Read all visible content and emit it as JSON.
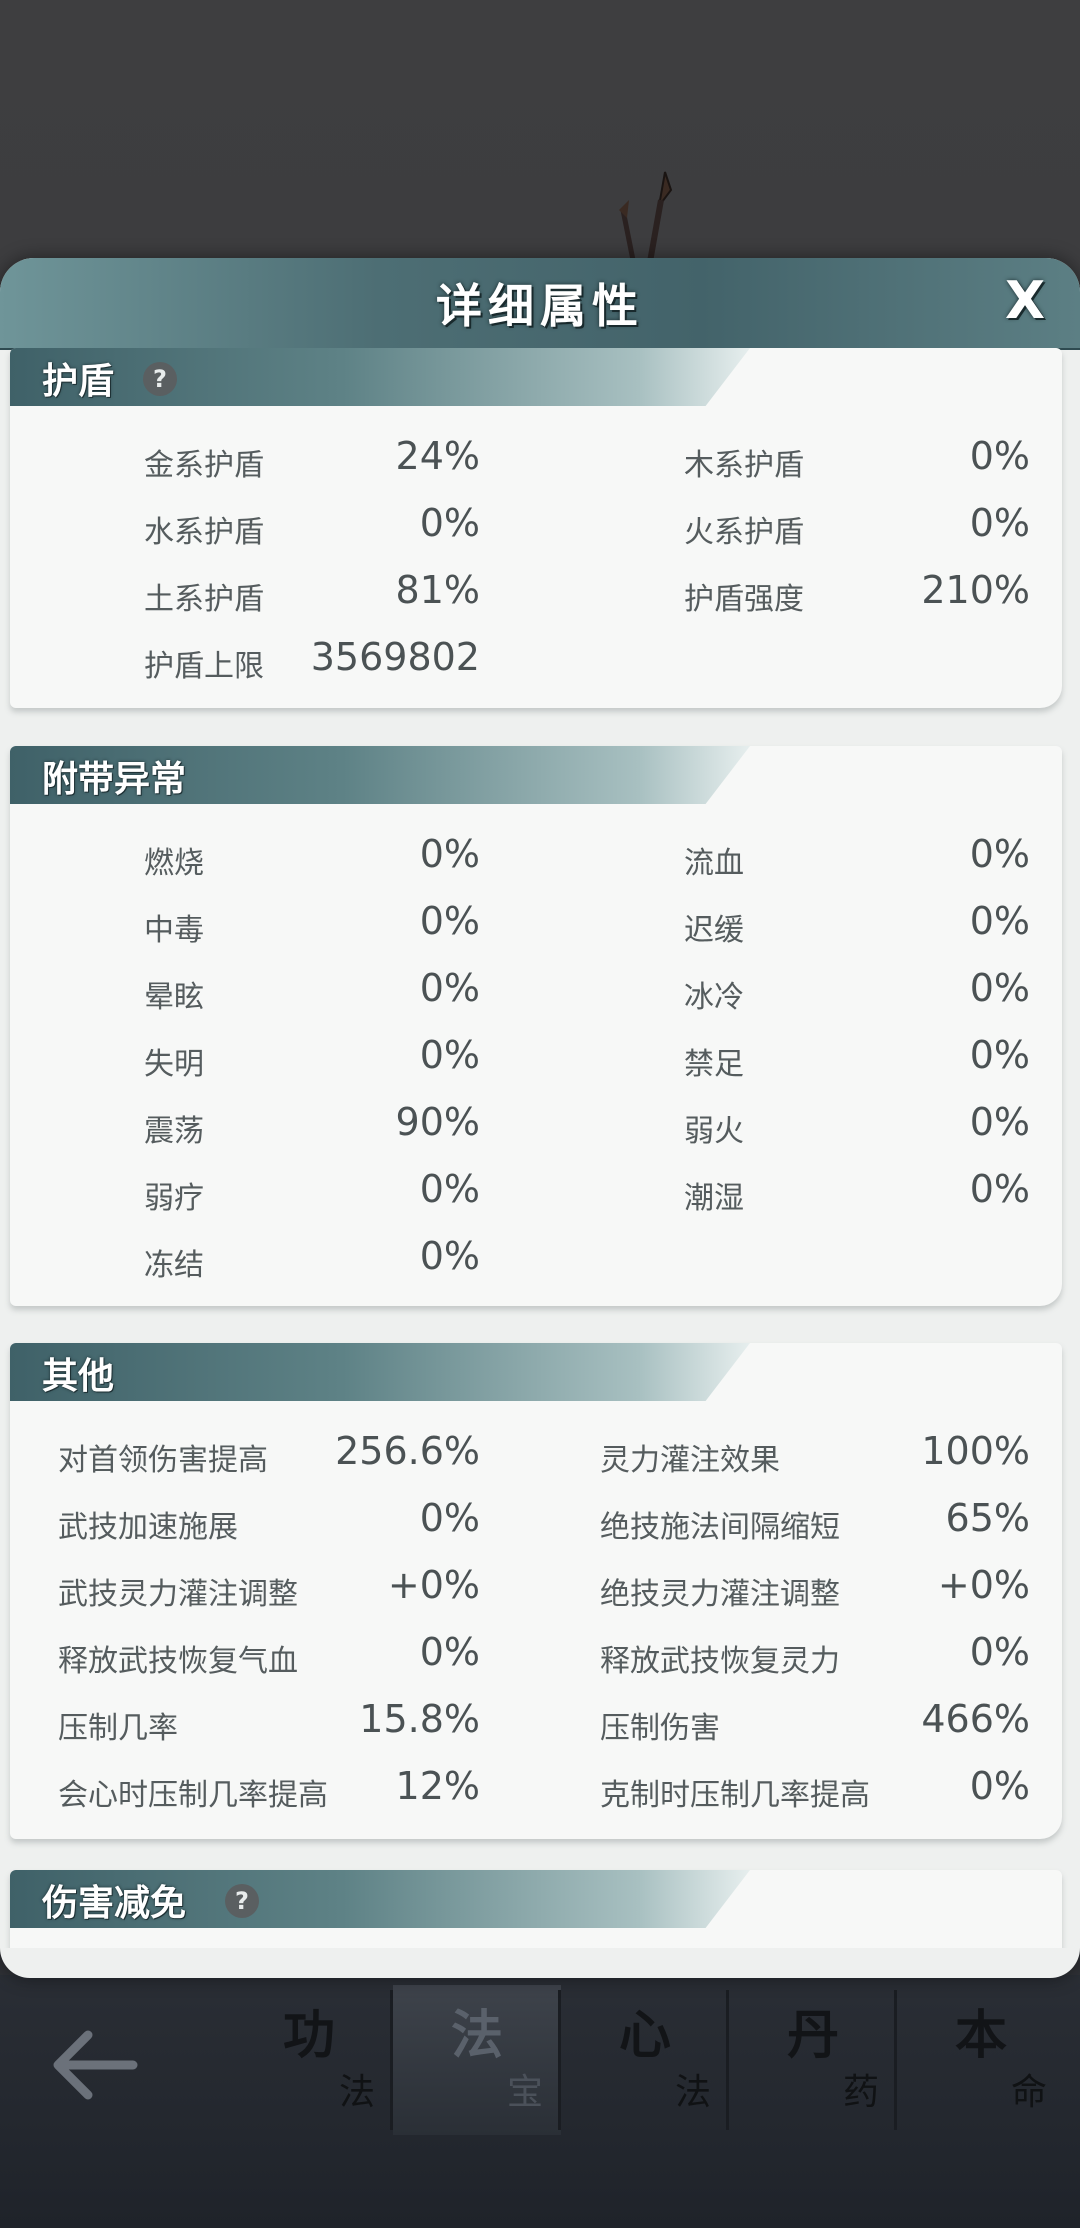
{
  "modal": {
    "title": "详细属性",
    "close_label": "X"
  },
  "sections": {
    "shield": {
      "title": "护盾",
      "help": "?",
      "rows": [
        {
          "left_label": "金系护盾",
          "left_value": "24%",
          "right_label": "木系护盾",
          "right_value": "0%"
        },
        {
          "left_label": "水系护盾",
          "left_value": "0%",
          "right_label": "火系护盾",
          "right_value": "0%"
        },
        {
          "left_label": "土系护盾",
          "left_value": "81%",
          "right_label": "护盾强度",
          "right_value": "210%"
        },
        {
          "left_label": "护盾上限",
          "left_value": "3569802"
        }
      ]
    },
    "ailment": {
      "title": "附带异常",
      "rows": [
        {
          "left_label": "燃烧",
          "left_value": "0%",
          "right_label": "流血",
          "right_value": "0%"
        },
        {
          "left_label": "中毒",
          "left_value": "0%",
          "right_label": "迟缓",
          "right_value": "0%"
        },
        {
          "left_label": "晕眩",
          "left_value": "0%",
          "right_label": "冰冷",
          "right_value": "0%"
        },
        {
          "left_label": "失明",
          "left_value": "0%",
          "right_label": "禁足",
          "right_value": "0%"
        },
        {
          "left_label": "震荡",
          "left_value": "90%",
          "right_label": "弱火",
          "right_value": "0%"
        },
        {
          "left_label": "弱疗",
          "left_value": "0%",
          "right_label": "潮湿",
          "right_value": "0%"
        },
        {
          "left_label": "冻结",
          "left_value": "0%"
        }
      ]
    },
    "other": {
      "title": "其他",
      "rows": [
        {
          "left_label": "对首领伤害提高",
          "left_value": "256.6%",
          "right_label": "灵力灌注效果",
          "right_value": "100%"
        },
        {
          "left_label": "武技加速施展",
          "left_value": "0%",
          "right_label": "绝技施法间隔缩短",
          "right_value": "65%"
        },
        {
          "left_label": "武技灵力灌注调整",
          "left_value": "+0%",
          "right_label": "绝技灵力灌注调整",
          "right_value": "+0%"
        },
        {
          "left_label": "释放武技恢复气血",
          "left_value": "0%",
          "right_label": "释放武技恢复灵力",
          "right_value": "0%"
        },
        {
          "left_label": "压制几率",
          "left_value": "15.8%",
          "right_label": "压制伤害",
          "right_value": "466%"
        },
        {
          "left_label": "会心时压制几率提高",
          "left_value": "12%",
          "right_label": "克制时压制几率提高",
          "right_value": "0%"
        }
      ]
    },
    "damage_reduction": {
      "title": "伤害减免",
      "help": "?"
    }
  },
  "nav": {
    "items": [
      {
        "big": "功",
        "small": "法"
      },
      {
        "big": "法",
        "small": "宝"
      },
      {
        "big": "心",
        "small": "法"
      },
      {
        "big": "丹",
        "small": "药"
      },
      {
        "big": "本",
        "small": "命"
      }
    ],
    "active_index": 1
  },
  "colors": {
    "header_teal": "#4d6e74",
    "card_bg": "#f7f8f7",
    "text_gray": "#4b5254"
  }
}
